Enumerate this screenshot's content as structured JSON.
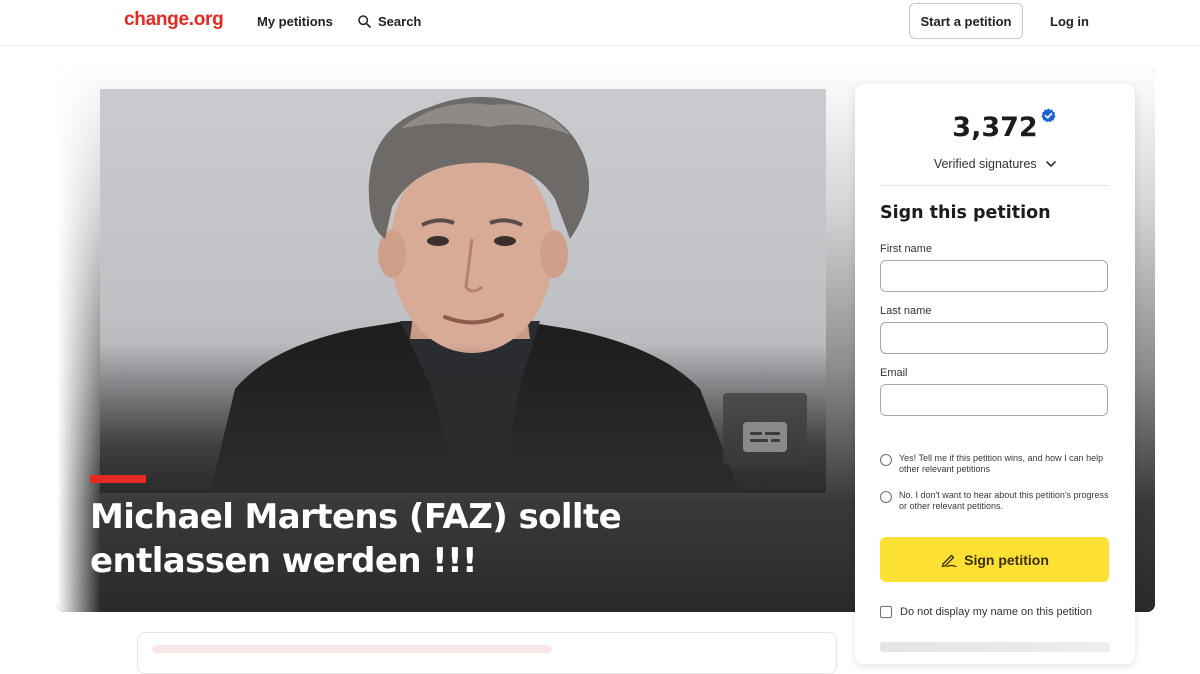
{
  "nav": {
    "logo": "change.org",
    "my_petitions": "My petitions",
    "search": "Search",
    "start_petition": "Start a petition",
    "log_in": "Log in"
  },
  "hero": {
    "title": "Michael Martens (FAZ) sollte entlassen werden !!!",
    "accent_color": "#e42b22"
  },
  "sign_card": {
    "count": "3,372",
    "verified_label": "Verified signatures",
    "heading": "Sign this petition",
    "first_name_label": "First name",
    "first_name_value": "",
    "last_name_label": "Last name",
    "last_name_value": "",
    "email_label": "Email",
    "email_value": "",
    "radio_yes": "Yes! Tell me if this petition wins, and how I can help other relevant petitions",
    "radio_no": "No. I don't want to hear about this petition's progress or other relevant petitions.",
    "sign_button": "Sign petition",
    "hide_name": "Do not display my name on this petition",
    "button_color": "#fde034",
    "badge_color": "#1a63d6"
  },
  "icons": {
    "search": "search-icon",
    "verified": "verified-badge-icon",
    "chevron": "chevron-down-icon",
    "pen": "pen-icon",
    "caption": "closed-caption-icon"
  }
}
